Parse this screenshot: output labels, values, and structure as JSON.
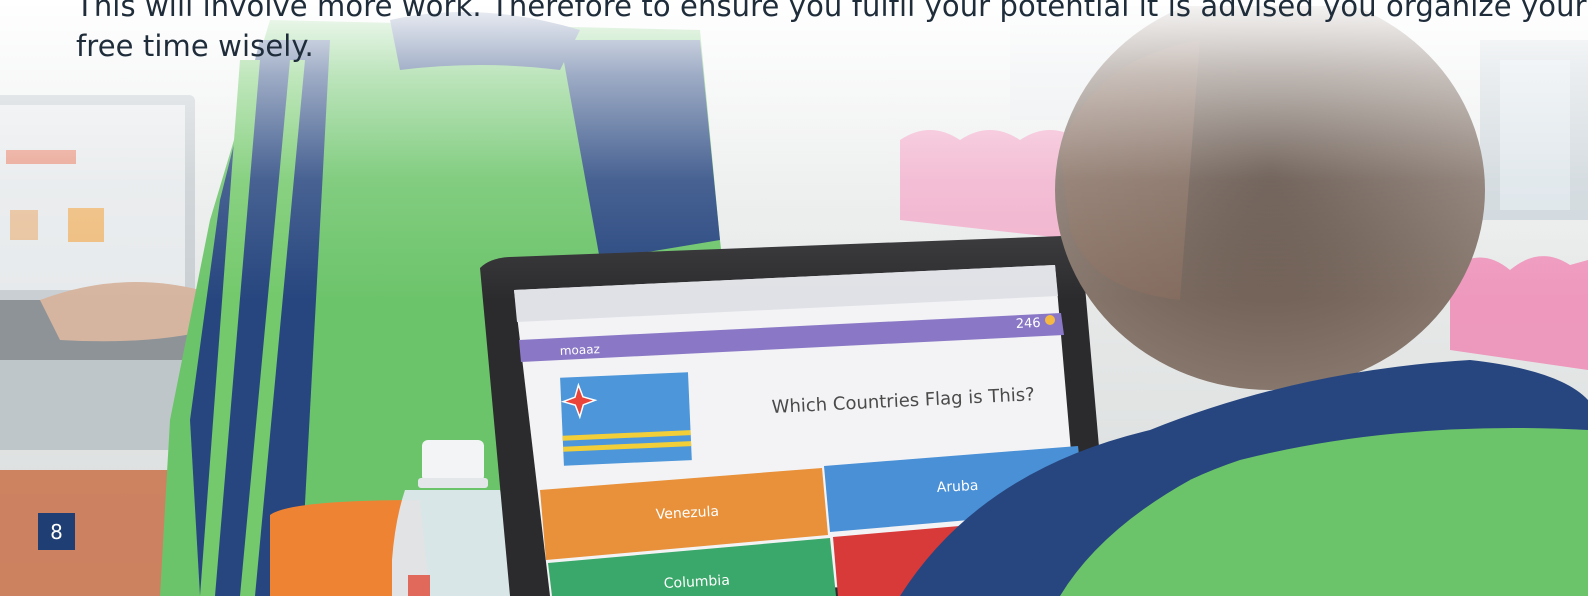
{
  "document": {
    "body_lines": [
      "This will involve more work. Therefore to ensure you fulfil your potential it is advised you organize your",
      "free time wisely."
    ],
    "page_number": "8"
  },
  "photo": {
    "laptop_screen": {
      "score": "246",
      "player": "moaaz",
      "question": "Which Countries Flag is This?",
      "answers": [
        "Venezula",
        "Aruba",
        "Columbia"
      ],
      "flag_icon": "aruba-flag-icon"
    },
    "colors": {
      "page_number_bg": "#1f3e73",
      "shirt_green": "#6cc46a",
      "shirt_navy": "#27467f",
      "answer_orange": "#e8913a",
      "answer_blue": "#4a90d6",
      "answer_green": "#3aa86a",
      "quiz_header_purple": "#8a78c6"
    }
  }
}
